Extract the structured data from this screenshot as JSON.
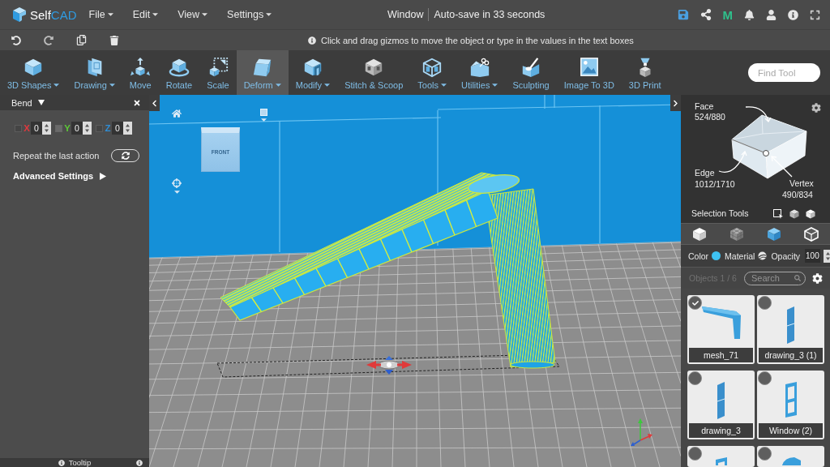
{
  "menubar": {
    "logo": {
      "text": "Self",
      "accent": "CAD"
    },
    "menus": [
      "File",
      "Edit",
      "View",
      "Settings"
    ],
    "title": "Window",
    "autosave": "Auto-save in 33 seconds",
    "m_button": "M"
  },
  "actionbar": {
    "hint": "Click and drag gizmos to move the object or type in the values in the text boxes"
  },
  "toolbar": {
    "tools": [
      {
        "label": "3D Shapes",
        "kind": "shapes",
        "dropdown": true,
        "selected": false
      },
      {
        "label": "Drawing",
        "kind": "drawing",
        "dropdown": true,
        "selected": false
      },
      {
        "label": "Move",
        "kind": "move",
        "dropdown": false,
        "selected": false
      },
      {
        "label": "Rotate",
        "kind": "rotate",
        "dropdown": false,
        "selected": false
      },
      {
        "label": "Scale",
        "kind": "scale",
        "dropdown": false,
        "selected": false
      },
      {
        "label": "Deform",
        "kind": "deform",
        "dropdown": true,
        "selected": true
      },
      {
        "label": "Modify",
        "kind": "modify",
        "dropdown": true,
        "selected": false
      },
      {
        "label": "Stitch & Scoop",
        "kind": "stitch",
        "dropdown": false,
        "selected": false
      },
      {
        "label": "Tools",
        "kind": "tools",
        "dropdown": true,
        "selected": false
      },
      {
        "label": "Utilities",
        "kind": "utilities",
        "dropdown": true,
        "selected": false
      },
      {
        "label": "Sculpting",
        "kind": "sculpting",
        "dropdown": false,
        "selected": false
      },
      {
        "label": "Image To 3D",
        "kind": "image",
        "dropdown": false,
        "selected": false
      },
      {
        "label": "3D Print",
        "kind": "print",
        "dropdown": false,
        "selected": false
      }
    ],
    "search": {
      "placeholder": "Find Tool"
    }
  },
  "left_panel": {
    "title": "Bend",
    "axes": [
      {
        "label": "X",
        "color": "#e0393e",
        "disabled": false,
        "value": "0"
      },
      {
        "label": "Y",
        "color": "#5cc936",
        "disabled": true,
        "value": "0"
      },
      {
        "label": "Z",
        "color": "#2f8fd8",
        "disabled": false,
        "value": "0"
      }
    ],
    "repeat_label": "Repeat the last action",
    "advanced_label": "Advanced Settings",
    "tooltip_label": "Tooltip"
  },
  "viewport": {
    "view_cube_label": "FRONT"
  },
  "right_panel": {
    "selection_info": {
      "face_label": "Face",
      "face_count": "524/880",
      "edge_label": "Edge",
      "edge_count": "1012/1710",
      "vertex_label": "Vertex",
      "vertex_count": "490/834",
      "tools_label": "Selection Tools"
    },
    "modes": [
      {
        "kind": "object",
        "selected": false
      },
      {
        "kind": "mesh",
        "selected": false
      },
      {
        "kind": "face",
        "selected": true
      },
      {
        "kind": "edge",
        "selected": false
      }
    ],
    "appearance": {
      "color_label": "Color",
      "material_label": "Material",
      "opacity_label": "Opacity",
      "opacity_value": "100"
    },
    "objects": {
      "count": "Objects 1 / 6",
      "search": {
        "placeholder": "Search"
      },
      "items": [
        {
          "name": "mesh_71",
          "kind": "bent",
          "selected": true
        },
        {
          "name": "drawing_3 (1)",
          "kind": "panel",
          "selected": false
        },
        {
          "name": "drawing_3",
          "kind": "panel",
          "selected": false
        },
        {
          "name": "Window (2)",
          "kind": "frame",
          "selected": false
        },
        {
          "kind": "frame",
          "selected": false
        },
        {
          "kind": "arch",
          "selected": false
        }
      ]
    }
  }
}
